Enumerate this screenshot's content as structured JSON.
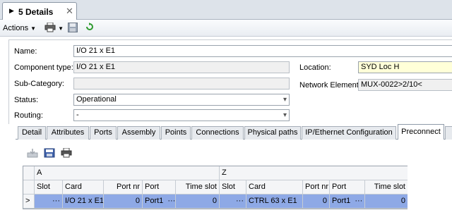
{
  "document_tab": {
    "title": "5 Details",
    "expand_glyph": "▶",
    "close_glyph": "✕"
  },
  "toolbar": {
    "actions_label": "Actions",
    "icons": [
      "dropdown-arrow",
      "print-icon",
      "save-icon",
      "refresh-icon"
    ]
  },
  "form": {
    "name": {
      "label": "Name:",
      "value": "I/O 21 x E1"
    },
    "component_type": {
      "label": "Component type:",
      "value": "I/O 21 x E1"
    },
    "sub_category": {
      "label": "Sub-Category:",
      "value": ""
    },
    "status": {
      "label": "Status:",
      "value": "Operational"
    },
    "routing": {
      "label": "Routing:",
      "value": "-"
    },
    "location": {
      "label": "Location:",
      "value": "SYD Loc H"
    },
    "network_element": {
      "label": "Network Element:",
      "value": "MUX-0022>2/10<"
    }
  },
  "tabs": [
    "Detail",
    "Attributes",
    "Ports",
    "Assembly",
    "Points",
    "Connections",
    "Physical paths",
    "IP/Ethernet Configuration",
    "Preconnect"
  ],
  "active_tab": "Preconnect",
  "grid": {
    "group_a": "A",
    "group_z": "Z",
    "columns": [
      "Slot",
      "Card",
      "Port nr",
      "Port",
      "Time slot",
      "Slot",
      "Card",
      "Port nr",
      "Port",
      "Time slot"
    ],
    "row": {
      "row_marker": ">",
      "a_slot": "···",
      "a_card": "I/O 21 x E1",
      "a_port_nr": "0",
      "a_port": "Port1",
      "a_port_dots": "···",
      "a_time_slot": "0",
      "z_slot": "···",
      "z_card": "CTRL 63 x E1",
      "z_port_nr": "0",
      "z_port": "Port1",
      "z_port_dots": "···",
      "z_time_slot": "0"
    }
  },
  "colors": {
    "selection": "#8ea9e6",
    "location_bg": "#ffffd8",
    "frame": "#dde3ea"
  }
}
